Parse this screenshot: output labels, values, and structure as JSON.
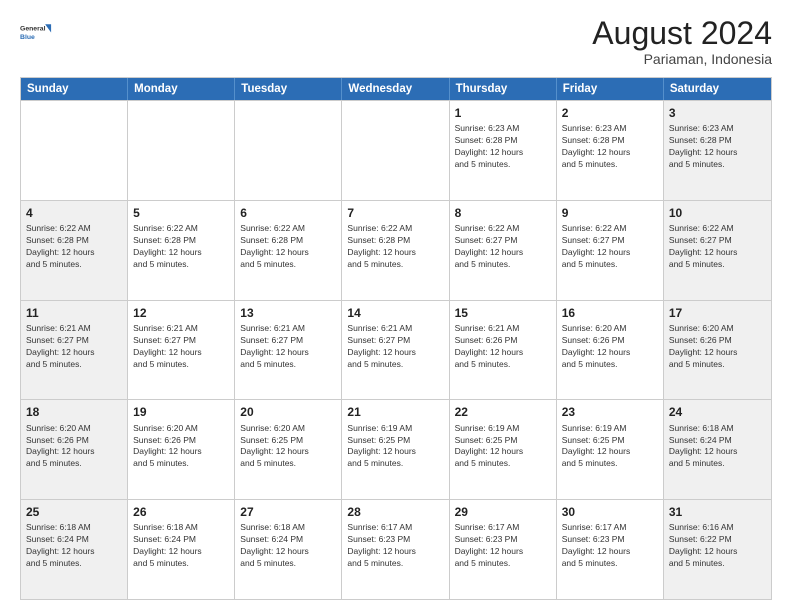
{
  "header": {
    "logo_line1": "General",
    "logo_line2": "Blue",
    "main_title": "August 2024",
    "subtitle": "Pariaman, Indonesia"
  },
  "calendar": {
    "days_of_week": [
      "Sunday",
      "Monday",
      "Tuesday",
      "Wednesday",
      "Thursday",
      "Friday",
      "Saturday"
    ],
    "rows": [
      [
        {
          "num": "",
          "info": "",
          "empty": true
        },
        {
          "num": "",
          "info": "",
          "empty": true
        },
        {
          "num": "",
          "info": "",
          "empty": true
        },
        {
          "num": "",
          "info": "",
          "empty": true
        },
        {
          "num": "1",
          "info": "Sunrise: 6:23 AM\nSunset: 6:28 PM\nDaylight: 12 hours\nand 5 minutes."
        },
        {
          "num": "2",
          "info": "Sunrise: 6:23 AM\nSunset: 6:28 PM\nDaylight: 12 hours\nand 5 minutes."
        },
        {
          "num": "3",
          "info": "Sunrise: 6:23 AM\nSunset: 6:28 PM\nDaylight: 12 hours\nand 5 minutes."
        }
      ],
      [
        {
          "num": "4",
          "info": "Sunrise: 6:22 AM\nSunset: 6:28 PM\nDaylight: 12 hours\nand 5 minutes."
        },
        {
          "num": "5",
          "info": "Sunrise: 6:22 AM\nSunset: 6:28 PM\nDaylight: 12 hours\nand 5 minutes."
        },
        {
          "num": "6",
          "info": "Sunrise: 6:22 AM\nSunset: 6:28 PM\nDaylight: 12 hours\nand 5 minutes."
        },
        {
          "num": "7",
          "info": "Sunrise: 6:22 AM\nSunset: 6:28 PM\nDaylight: 12 hours\nand 5 minutes."
        },
        {
          "num": "8",
          "info": "Sunrise: 6:22 AM\nSunset: 6:27 PM\nDaylight: 12 hours\nand 5 minutes."
        },
        {
          "num": "9",
          "info": "Sunrise: 6:22 AM\nSunset: 6:27 PM\nDaylight: 12 hours\nand 5 minutes."
        },
        {
          "num": "10",
          "info": "Sunrise: 6:22 AM\nSunset: 6:27 PM\nDaylight: 12 hours\nand 5 minutes."
        }
      ],
      [
        {
          "num": "11",
          "info": "Sunrise: 6:21 AM\nSunset: 6:27 PM\nDaylight: 12 hours\nand 5 minutes."
        },
        {
          "num": "12",
          "info": "Sunrise: 6:21 AM\nSunset: 6:27 PM\nDaylight: 12 hours\nand 5 minutes."
        },
        {
          "num": "13",
          "info": "Sunrise: 6:21 AM\nSunset: 6:27 PM\nDaylight: 12 hours\nand 5 minutes."
        },
        {
          "num": "14",
          "info": "Sunrise: 6:21 AM\nSunset: 6:27 PM\nDaylight: 12 hours\nand 5 minutes."
        },
        {
          "num": "15",
          "info": "Sunrise: 6:21 AM\nSunset: 6:26 PM\nDaylight: 12 hours\nand 5 minutes."
        },
        {
          "num": "16",
          "info": "Sunrise: 6:20 AM\nSunset: 6:26 PM\nDaylight: 12 hours\nand 5 minutes."
        },
        {
          "num": "17",
          "info": "Sunrise: 6:20 AM\nSunset: 6:26 PM\nDaylight: 12 hours\nand 5 minutes."
        }
      ],
      [
        {
          "num": "18",
          "info": "Sunrise: 6:20 AM\nSunset: 6:26 PM\nDaylight: 12 hours\nand 5 minutes."
        },
        {
          "num": "19",
          "info": "Sunrise: 6:20 AM\nSunset: 6:26 PM\nDaylight: 12 hours\nand 5 minutes."
        },
        {
          "num": "20",
          "info": "Sunrise: 6:20 AM\nSunset: 6:25 PM\nDaylight: 12 hours\nand 5 minutes."
        },
        {
          "num": "21",
          "info": "Sunrise: 6:19 AM\nSunset: 6:25 PM\nDaylight: 12 hours\nand 5 minutes."
        },
        {
          "num": "22",
          "info": "Sunrise: 6:19 AM\nSunset: 6:25 PM\nDaylight: 12 hours\nand 5 minutes."
        },
        {
          "num": "23",
          "info": "Sunrise: 6:19 AM\nSunset: 6:25 PM\nDaylight: 12 hours\nand 5 minutes."
        },
        {
          "num": "24",
          "info": "Sunrise: 6:18 AM\nSunset: 6:24 PM\nDaylight: 12 hours\nand 5 minutes."
        }
      ],
      [
        {
          "num": "25",
          "info": "Sunrise: 6:18 AM\nSunset: 6:24 PM\nDaylight: 12 hours\nand 5 minutes."
        },
        {
          "num": "26",
          "info": "Sunrise: 6:18 AM\nSunset: 6:24 PM\nDaylight: 12 hours\nand 5 minutes."
        },
        {
          "num": "27",
          "info": "Sunrise: 6:18 AM\nSunset: 6:24 PM\nDaylight: 12 hours\nand 5 minutes."
        },
        {
          "num": "28",
          "info": "Sunrise: 6:17 AM\nSunset: 6:23 PM\nDaylight: 12 hours\nand 5 minutes."
        },
        {
          "num": "29",
          "info": "Sunrise: 6:17 AM\nSunset: 6:23 PM\nDaylight: 12 hours\nand 5 minutes."
        },
        {
          "num": "30",
          "info": "Sunrise: 6:17 AM\nSunset: 6:23 PM\nDaylight: 12 hours\nand 5 minutes."
        },
        {
          "num": "31",
          "info": "Sunrise: 6:16 AM\nSunset: 6:22 PM\nDaylight: 12 hours\nand 5 minutes."
        }
      ]
    ]
  }
}
